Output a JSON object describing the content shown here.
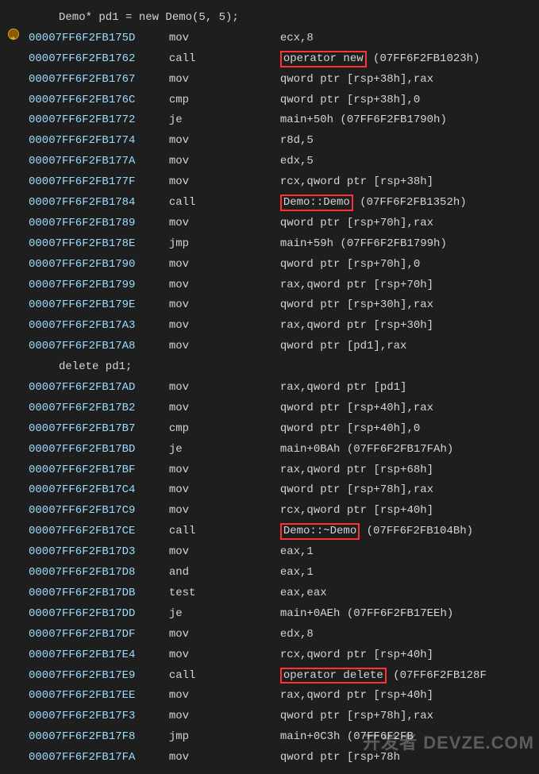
{
  "gutter": {
    "breakpoint_active": true
  },
  "watermark": "开发者 DEVZE.COM",
  "lines": [
    {
      "type": "src",
      "text": "Demo* pd1 = new Demo(5, 5);"
    },
    {
      "type": "asm",
      "addr": "00007FF6F2FB175D",
      "mnemonic": "mov",
      "operand_pre": "ecx,8"
    },
    {
      "type": "asm",
      "addr": "00007FF6F2FB1762",
      "mnemonic": "call",
      "hl": "operator new",
      "operand_post": " (07FF6F2FB1023h)"
    },
    {
      "type": "asm",
      "addr": "00007FF6F2FB1767",
      "mnemonic": "mov",
      "operand_pre": "qword ptr [rsp+38h],rax"
    },
    {
      "type": "asm",
      "addr": "00007FF6F2FB176C",
      "mnemonic": "cmp",
      "operand_pre": "qword ptr [rsp+38h],0"
    },
    {
      "type": "asm",
      "addr": "00007FF6F2FB1772",
      "mnemonic": "je",
      "operand_pre": "main+50h (07FF6F2FB1790h)"
    },
    {
      "type": "asm",
      "addr": "00007FF6F2FB1774",
      "mnemonic": "mov",
      "operand_pre": "r8d,5"
    },
    {
      "type": "asm",
      "addr": "00007FF6F2FB177A",
      "mnemonic": "mov",
      "operand_pre": "edx,5"
    },
    {
      "type": "asm",
      "addr": "00007FF6F2FB177F",
      "mnemonic": "mov",
      "operand_pre": "rcx,qword ptr [rsp+38h]"
    },
    {
      "type": "asm",
      "addr": "00007FF6F2FB1784",
      "mnemonic": "call",
      "hl": "Demo::Demo",
      "operand_post": " (07FF6F2FB1352h)"
    },
    {
      "type": "asm",
      "addr": "00007FF6F2FB1789",
      "mnemonic": "mov",
      "operand_pre": "qword ptr [rsp+70h],rax"
    },
    {
      "type": "asm",
      "addr": "00007FF6F2FB178E",
      "mnemonic": "jmp",
      "operand_pre": "main+59h (07FF6F2FB1799h)"
    },
    {
      "type": "asm",
      "addr": "00007FF6F2FB1790",
      "mnemonic": "mov",
      "operand_pre": "qword ptr [rsp+70h],0"
    },
    {
      "type": "asm",
      "addr": "00007FF6F2FB1799",
      "mnemonic": "mov",
      "operand_pre": "rax,qword ptr [rsp+70h]"
    },
    {
      "type": "asm",
      "addr": "00007FF6F2FB179E",
      "mnemonic": "mov",
      "operand_pre": "qword ptr [rsp+30h],rax"
    },
    {
      "type": "asm",
      "addr": "00007FF6F2FB17A3",
      "mnemonic": "mov",
      "operand_pre": "rax,qword ptr [rsp+30h]"
    },
    {
      "type": "asm",
      "addr": "00007FF6F2FB17A8",
      "mnemonic": "mov",
      "operand_pre": "qword ptr [pd1],rax"
    },
    {
      "type": "src",
      "text": "delete pd1;"
    },
    {
      "type": "asm",
      "addr": "00007FF6F2FB17AD",
      "mnemonic": "mov",
      "operand_pre": "rax,qword ptr [pd1]"
    },
    {
      "type": "asm",
      "addr": "00007FF6F2FB17B2",
      "mnemonic": "mov",
      "operand_pre": "qword ptr [rsp+40h],rax"
    },
    {
      "type": "asm",
      "addr": "00007FF6F2FB17B7",
      "mnemonic": "cmp",
      "operand_pre": "qword ptr [rsp+40h],0"
    },
    {
      "type": "asm",
      "addr": "00007FF6F2FB17BD",
      "mnemonic": "je",
      "operand_pre": "main+0BAh (07FF6F2FB17FAh)"
    },
    {
      "type": "asm",
      "addr": "00007FF6F2FB17BF",
      "mnemonic": "mov",
      "operand_pre": "rax,qword ptr [rsp+68h]"
    },
    {
      "type": "asm",
      "addr": "00007FF6F2FB17C4",
      "mnemonic": "mov",
      "operand_pre": "qword ptr [rsp+78h],rax"
    },
    {
      "type": "asm",
      "addr": "00007FF6F2FB17C9",
      "mnemonic": "mov",
      "operand_pre": "rcx,qword ptr [rsp+40h]"
    },
    {
      "type": "asm",
      "addr": "00007FF6F2FB17CE",
      "mnemonic": "call",
      "hl": "Demo::~Demo",
      "operand_post": " (07FF6F2FB104Bh)"
    },
    {
      "type": "asm",
      "addr": "00007FF6F2FB17D3",
      "mnemonic": "mov",
      "operand_pre": "eax,1"
    },
    {
      "type": "asm",
      "addr": "00007FF6F2FB17D8",
      "mnemonic": "and",
      "operand_pre": "eax,1"
    },
    {
      "type": "asm",
      "addr": "00007FF6F2FB17DB",
      "mnemonic": "test",
      "operand_pre": "eax,eax"
    },
    {
      "type": "asm",
      "addr": "00007FF6F2FB17DD",
      "mnemonic": "je",
      "operand_pre": "main+0AEh (07FF6F2FB17EEh)"
    },
    {
      "type": "asm",
      "addr": "00007FF6F2FB17DF",
      "mnemonic": "mov",
      "operand_pre": "edx,8"
    },
    {
      "type": "asm",
      "addr": "00007FF6F2FB17E4",
      "mnemonic": "mov",
      "operand_pre": "rcx,qword ptr [rsp+40h]"
    },
    {
      "type": "asm",
      "addr": "00007FF6F2FB17E9",
      "mnemonic": "call",
      "hl": "operator delete",
      "operand_post": " (07FF6F2FB128F"
    },
    {
      "type": "asm",
      "addr": "00007FF6F2FB17EE",
      "mnemonic": "mov",
      "operand_pre": "rax,qword ptr [rsp+40h]"
    },
    {
      "type": "asm",
      "addr": "00007FF6F2FB17F3",
      "mnemonic": "mov",
      "operand_pre": "qword ptr [rsp+78h],rax"
    },
    {
      "type": "asm",
      "addr": "00007FF6F2FB17F8",
      "mnemonic": "jmp",
      "operand_pre": "main+0C3h (07FF6F2FB"
    },
    {
      "type": "asm",
      "addr": "00007FF6F2FB17FA",
      "mnemonic": "mov",
      "operand_pre": "qword ptr [rsp+78h"
    }
  ]
}
